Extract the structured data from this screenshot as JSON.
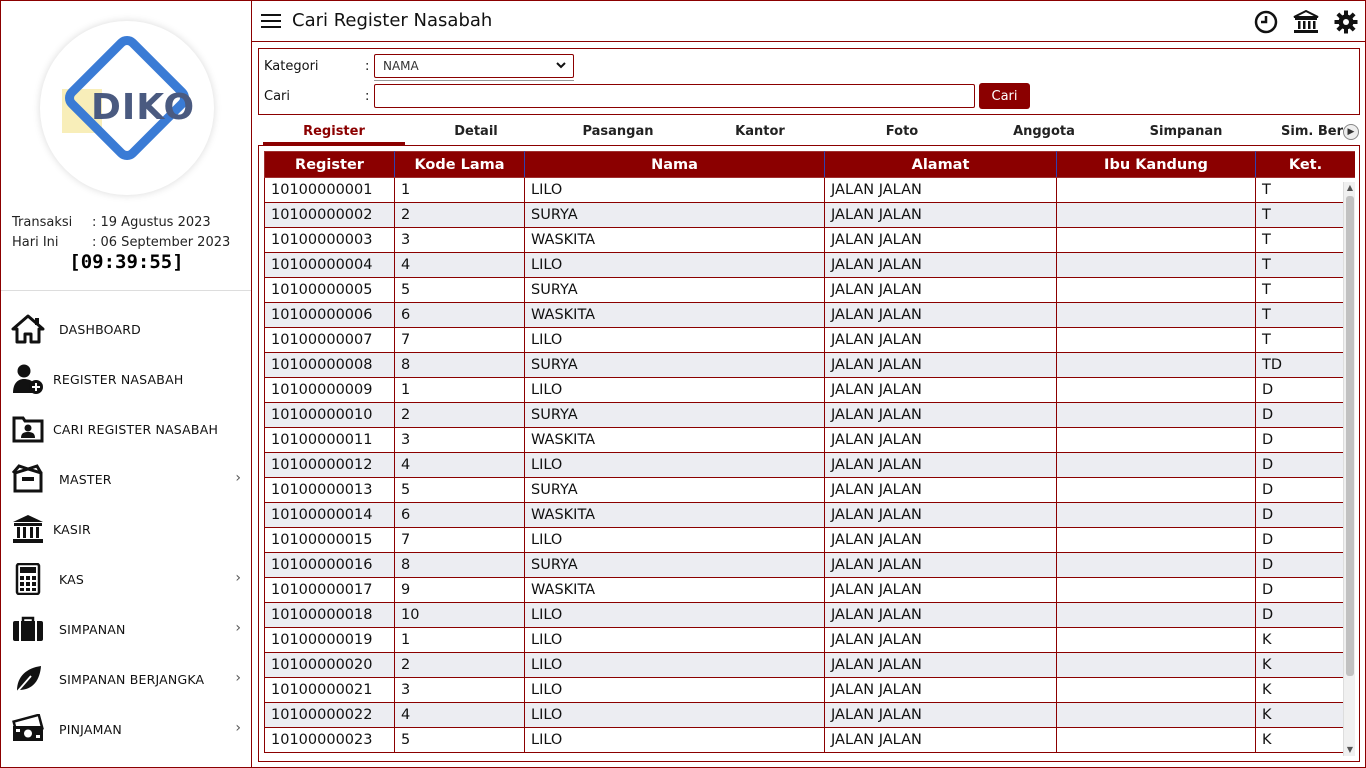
{
  "app": {
    "logo_text": "DIKO"
  },
  "header": {
    "title": "Cari Register Nasabah"
  },
  "info": {
    "transaksi_label": "Transaksi",
    "transaksi_value": ": 19 Agustus 2023",
    "hari_ini_label": "Hari Ini",
    "hari_ini_value": ": 06 September 2023",
    "clock": "[09:39:55]"
  },
  "menu": {
    "items": [
      {
        "label": "DASHBOARD",
        "icon": "home-icon",
        "has_arrow": false
      },
      {
        "label": "REGISTER NASABAH",
        "icon": "add-user-icon",
        "has_arrow": false
      },
      {
        "label": "CARI REGISTER NASABAH",
        "icon": "contact-card-icon",
        "has_arrow": false
      },
      {
        "label": "MASTER",
        "icon": "box-icon",
        "has_arrow": true
      },
      {
        "label": "KASIR",
        "icon": "bank-icon",
        "has_arrow": false
      },
      {
        "label": "KAS",
        "icon": "calculator-icon",
        "has_arrow": true
      },
      {
        "label": "SIMPANAN",
        "icon": "briefcase-icon",
        "has_arrow": true
      },
      {
        "label": "SIMPANAN BERJANGKA",
        "icon": "leaf-icon",
        "has_arrow": true
      },
      {
        "label": "PINJAMAN",
        "icon": "money-icon",
        "has_arrow": true
      }
    ],
    "arrow": "›"
  },
  "search": {
    "kategori_label": "Kategori",
    "cari_label": "Cari",
    "colon": ":",
    "kategori_value": "NAMA",
    "cari_value": "",
    "button_label": "Cari"
  },
  "tabs": [
    {
      "label": "Register",
      "active": true
    },
    {
      "label": "Detail",
      "active": false
    },
    {
      "label": "Pasangan",
      "active": false
    },
    {
      "label": "Kantor",
      "active": false
    },
    {
      "label": "Foto",
      "active": false
    },
    {
      "label": "Anggota",
      "active": false
    },
    {
      "label": "Simpanan",
      "active": false
    },
    {
      "label": "Sim. Ber",
      "active": false
    }
  ],
  "table": {
    "columns": [
      "Register",
      "Kode Lama",
      "Nama",
      "Alamat",
      "Ibu Kandung",
      "Ket."
    ],
    "rows": [
      [
        "10100000001",
        "1",
        "LILO",
        "JALAN JALAN",
        "",
        "T"
      ],
      [
        "10100000002",
        "2",
        "SURYA",
        "JALAN JALAN",
        "",
        "T"
      ],
      [
        "10100000003",
        "3",
        "WASKITA",
        "JALAN JALAN",
        "",
        "T"
      ],
      [
        "10100000004",
        "4",
        "LILO",
        "JALAN JALAN",
        "",
        "T"
      ],
      [
        "10100000005",
        "5",
        "SURYA",
        "JALAN JALAN",
        "",
        "T"
      ],
      [
        "10100000006",
        "6",
        "WASKITA",
        "JALAN JALAN",
        "",
        "T"
      ],
      [
        "10100000007",
        "7",
        "LILO",
        "JALAN JALAN",
        "",
        "T"
      ],
      [
        "10100000008",
        "8",
        "SURYA",
        "JALAN JALAN",
        "",
        "TD"
      ],
      [
        "10100000009",
        "1",
        "LILO",
        "JALAN JALAN",
        "",
        "D"
      ],
      [
        "10100000010",
        "2",
        "SURYA",
        "JALAN JALAN",
        "",
        "D"
      ],
      [
        "10100000011",
        "3",
        "WASKITA",
        "JALAN JALAN",
        "",
        "D"
      ],
      [
        "10100000012",
        "4",
        "LILO",
        "JALAN JALAN",
        "",
        "D"
      ],
      [
        "10100000013",
        "5",
        "SURYA",
        "JALAN JALAN",
        "",
        "D"
      ],
      [
        "10100000014",
        "6",
        "WASKITA",
        "JALAN JALAN",
        "",
        "D"
      ],
      [
        "10100000015",
        "7",
        "LILO",
        "JALAN JALAN",
        "",
        "D"
      ],
      [
        "10100000016",
        "8",
        "SURYA",
        "JALAN JALAN",
        "",
        "D"
      ],
      [
        "10100000017",
        "9",
        "WASKITA",
        "JALAN JALAN",
        "",
        "D"
      ],
      [
        "10100000018",
        "10",
        "LILO",
        "JALAN JALAN",
        "",
        "D"
      ],
      [
        "10100000019",
        "1",
        "LILO",
        "JALAN JALAN",
        "",
        "K"
      ],
      [
        "10100000020",
        "2",
        "LILO",
        "JALAN JALAN",
        "",
        "K"
      ],
      [
        "10100000021",
        "3",
        "LILO",
        "JALAN JALAN",
        "",
        "K"
      ],
      [
        "10100000022",
        "4",
        "LILO",
        "JALAN JALAN",
        "",
        "K"
      ],
      [
        "10100000023",
        "5",
        "LILO",
        "JALAN JALAN",
        "",
        "K"
      ]
    ]
  },
  "colors": {
    "accent": "#8b0000",
    "row_alt": "#ecedf2",
    "logo_blue": "#3a7bd5"
  }
}
